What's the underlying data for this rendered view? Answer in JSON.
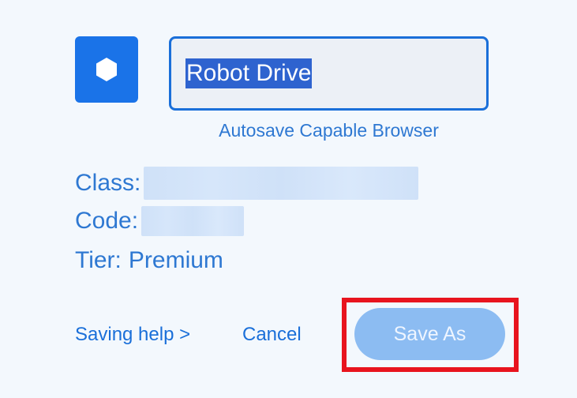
{
  "header": {
    "app_icon": "hexagon-icon",
    "name_input": {
      "value": "Robot Drive",
      "selected": true
    },
    "browser_label": "Autosave Capable Browser"
  },
  "info": {
    "class_label": "Class:",
    "code_label": "Code:",
    "tier_label": "Tier:",
    "tier_value": "Premium"
  },
  "actions": {
    "help_link": "Saving help >",
    "cancel_label": "Cancel",
    "save_as_label": "Save As",
    "save_as_disabled": true
  },
  "colors": {
    "accent": "#1a73e8",
    "text_blue": "#2e78d2",
    "selection": "#2e63cf",
    "disabled_button": "#8cbcf2",
    "highlight_frame": "#e8141e",
    "background": "#f3f8fd"
  }
}
